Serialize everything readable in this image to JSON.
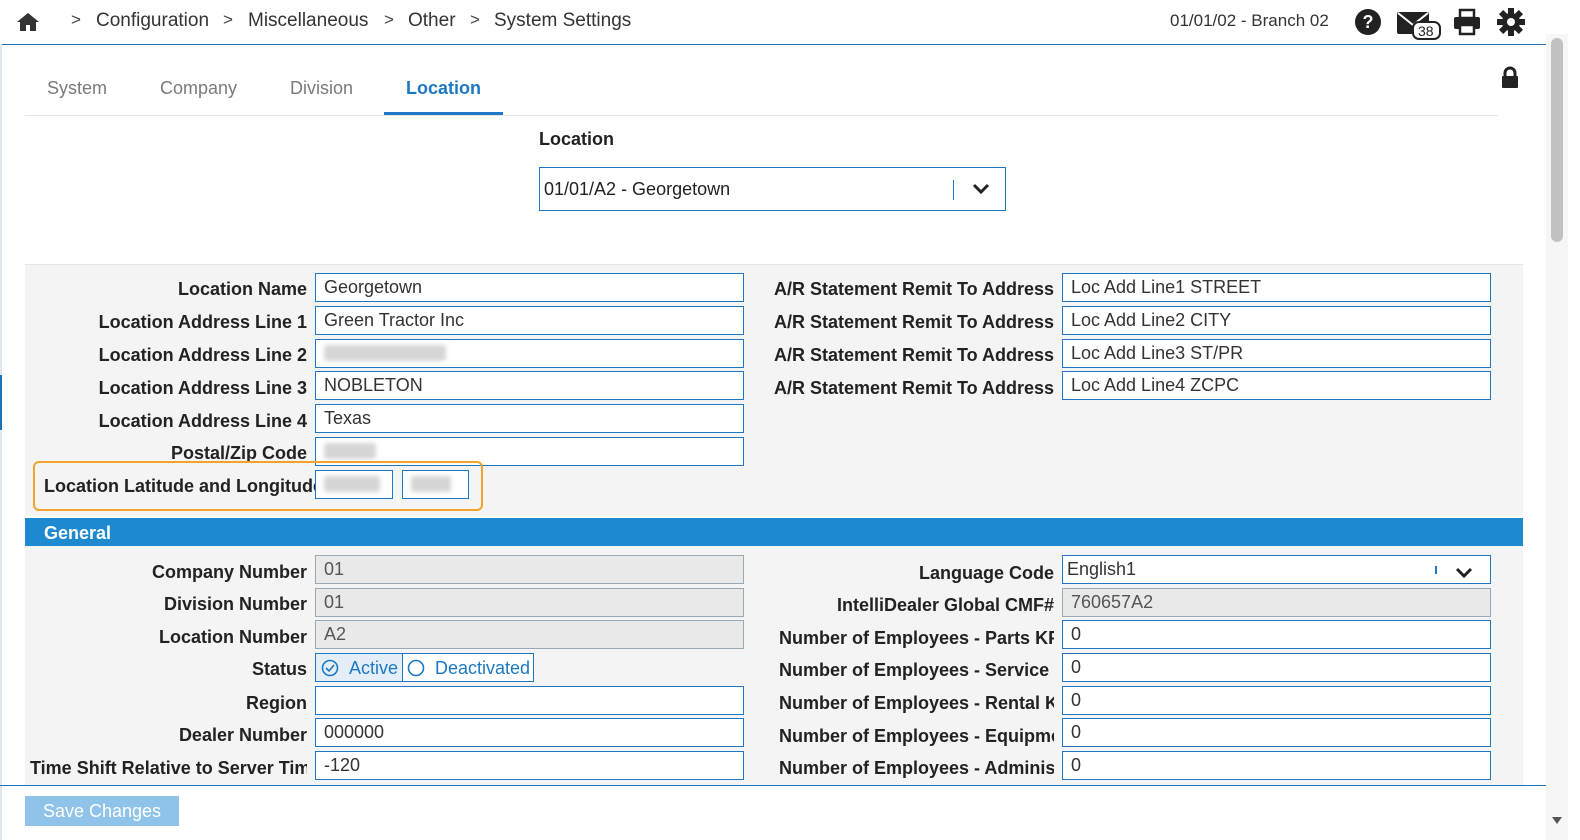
{
  "breadcrumb": {
    "items": [
      "Configuration",
      "Miscellaneous",
      "Other",
      "System Settings"
    ],
    "separator": ">"
  },
  "header": {
    "branch": "01/01/02 - Branch 02",
    "mail_count": "38",
    "accent_color": "#1d78c1"
  },
  "tabs": [
    "System",
    "Company",
    "Division",
    "Location"
  ],
  "active_tab": "Location",
  "location_select": {
    "label": "Location",
    "value": "01/01/A2 - Georgetown"
  },
  "address": {
    "location_name_label": "Location Name",
    "location_name": "Georgetown",
    "line1_label": "Location Address Line 1",
    "line1": "Green Tractor Inc",
    "line2_label": "Location Address Line 2",
    "line3_label": "Location Address Line 3",
    "line3": "NOBLETON",
    "line4_label": "Location Address Line 4",
    "line4": "Texas",
    "postal_label": "Postal/Zip Code",
    "latlong_label": "Location Latitude and Longitude",
    "remit_label": "A/R Statement Remit To Address",
    "remit1": "Loc Add Line1 STREET",
    "remit2": "Loc Add Line2 CITY",
    "remit3": "Loc Add Line3 ST/PR",
    "remit4": "Loc Add Line4 ZCPC"
  },
  "general": {
    "title": "General",
    "company_number_label": "Company Number",
    "company_number": "01",
    "division_number_label": "Division Number",
    "division_number": "01",
    "location_number_label": "Location Number",
    "location_number": "A2",
    "status_label": "Status",
    "status_active": "Active",
    "status_deactivated": "Deactivated",
    "region_label": "Region",
    "region": "",
    "dealer_number_label": "Dealer Number",
    "dealer_number": "000000",
    "time_shift_label": "Time Shift Relative to Server Time",
    "time_shift": "-120",
    "language_code_label": "Language Code",
    "language_code": "English1",
    "cmf_label": "IntelliDealer Global CMF#",
    "cmf": "760657A2",
    "emp_parts_label": "Number of Employees - Parts KPI",
    "emp_parts": "0",
    "emp_service_label": "Number of Employees - Service KPI",
    "emp_service": "0",
    "emp_rental_label": "Number of Employees - Rental KPI",
    "emp_rental": "0",
    "emp_equipment_label": "Number of Employees - Equipment KPI",
    "emp_equipment": "0",
    "emp_admin_label": "Number of Employees - Administration KPI",
    "emp_admin": "0"
  },
  "footer": {
    "save_label": "Save Changes"
  }
}
